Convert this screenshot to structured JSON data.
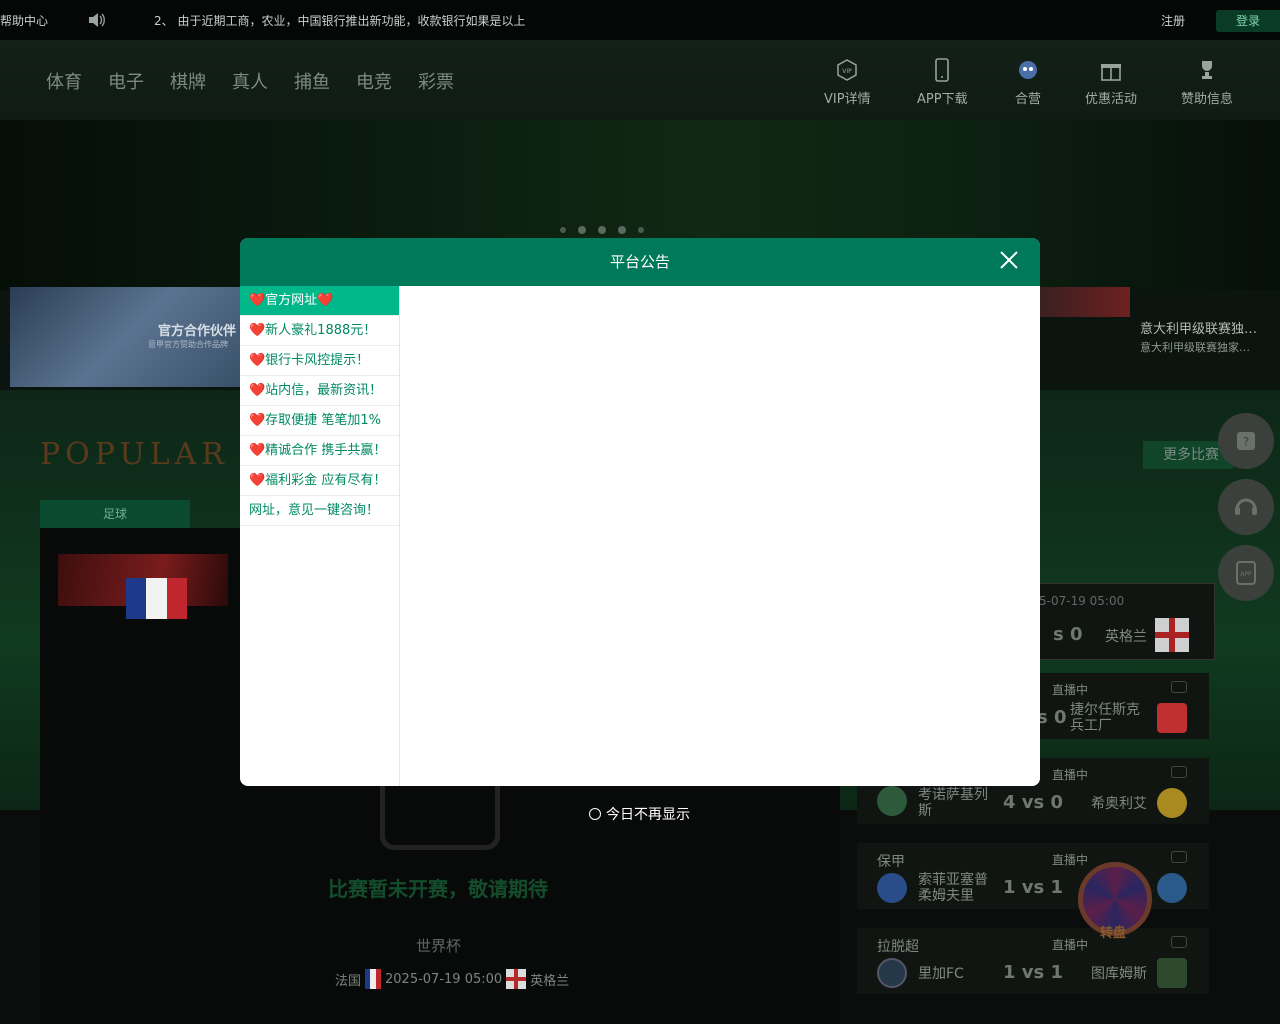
{
  "topbar": {
    "help": "帮助中心",
    "notice": "2、 由于近期工商，农业，中国银行推出新功能，收款银行如果是以上",
    "register": "注册",
    "login": "登录"
  },
  "nav": [
    "体育",
    "电子",
    "棋牌",
    "真人",
    "捕鱼",
    "电竞",
    "彩票"
  ],
  "quick_links": [
    {
      "label": "VIP详情",
      "icon": "vip-icon"
    },
    {
      "label": "APP下载",
      "icon": "phone-icon"
    },
    {
      "label": "合营",
      "icon": "partner-icon"
    },
    {
      "label": "优惠活动",
      "icon": "gift-icon"
    },
    {
      "label": "赞助信息",
      "icon": "trophy-icon"
    }
  ],
  "promo_left": {
    "title": "官方合作伙伴",
    "subtitle": "意甲官方赞助合作品牌"
  },
  "news_right": {
    "title": "意大利甲级联赛独…",
    "subtitle": "意大利甲级联赛独家…"
  },
  "popular": "POPULAR LI",
  "more_matches": "更多比赛",
  "tab": "足球",
  "main_match": {
    "no_match": "比赛暂未开赛，敬请期待",
    "cup": "世界杯",
    "home": "法国",
    "time": "2025-07-19 05:00",
    "away": "英格兰"
  },
  "top_card": {
    "datetime": "5-07-19 05:00",
    "score": "s 0",
    "away": "英格兰"
  },
  "cards": [
    {
      "league": "",
      "status": "直播中",
      "home": "",
      "score": "s 0",
      "away": "捷尔任斯克\n兵工厂"
    },
    {
      "league": "",
      "status": "直播中",
      "home": "考诺萨基列\n斯",
      "score": "4 vs 0",
      "away": "希奥利艾"
    },
    {
      "league": "保甲",
      "status": "直播中",
      "home": "索菲亚塞普\n柔姆夫里",
      "score": "1 vs 1",
      "away": ""
    },
    {
      "league": "拉脱超",
      "status": "直播中",
      "home": "里加FC",
      "score": "1 vs 1",
      "away": "图库姆斯"
    }
  ],
  "wheel_label": "转盘",
  "modal": {
    "title": "平台公告",
    "menu": [
      "❤️官方网址❤️",
      "❤️新人豪礼1888元！",
      "❤️银行卡风控提示！",
      "❤️站内信，最新资讯！",
      "❤️存取便捷  笔笔加1%",
      "❤️精诚合作  携手共赢！",
      "❤️福利彩金  应有尽有！",
      "网址，意见一键咨询！"
    ],
    "dont_show": "今日不再显示"
  },
  "colors": {
    "modal_header": "#00785a",
    "active_menu": "#00b78a",
    "menu_text": "#008a62"
  }
}
